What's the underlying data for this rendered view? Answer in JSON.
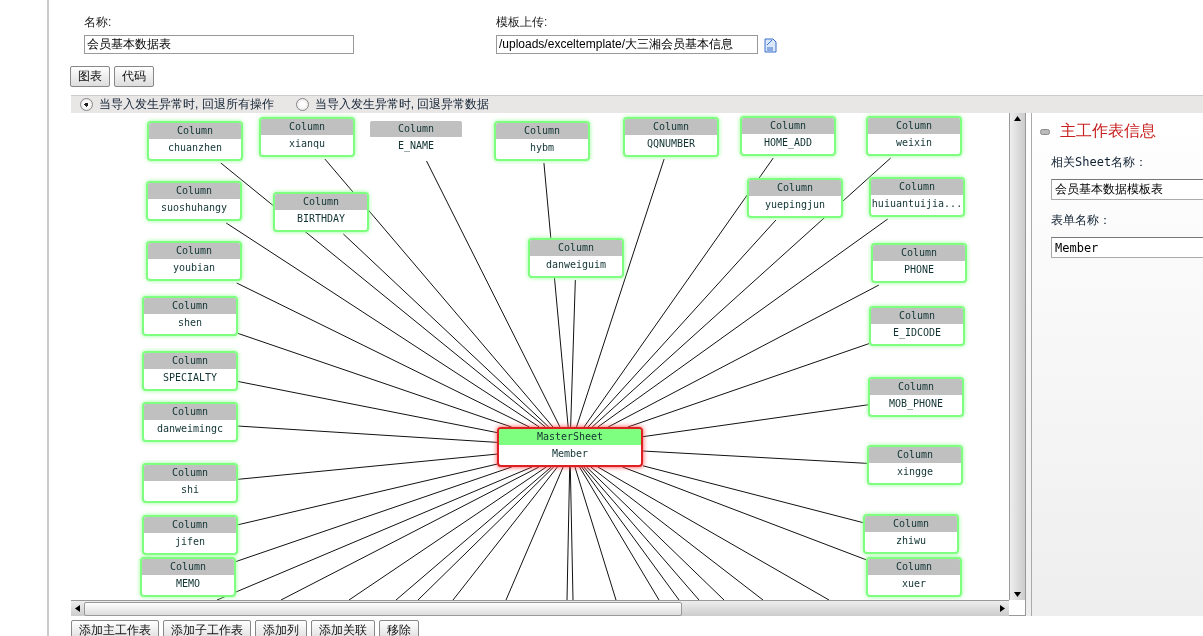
{
  "form": {
    "name_label": "名称:",
    "name_value": "会员基本数据表",
    "upload_label": "模板上传:",
    "upload_value": "/uploads/exceltemplate/大三湘会员基本信息"
  },
  "view_buttons": [
    {
      "label": "图表"
    },
    {
      "label": "代码"
    }
  ],
  "rollback_options": [
    {
      "label": "当导入发生异常时, 回退所有操作",
      "selected": true
    },
    {
      "label": "当导入发生异常时, 回退异常数据",
      "selected": false
    }
  ],
  "diagram": {
    "master": {
      "header": "MasterSheet",
      "name": "Member"
    },
    "columns": [
      {
        "kind": "node",
        "header": "Column",
        "name": "chuanzhen"
      },
      {
        "kind": "node",
        "header": "Column",
        "name": "xianqu"
      },
      {
        "kind": "plain",
        "header": "Column",
        "name": "E_NAME"
      },
      {
        "kind": "node",
        "header": "Column",
        "name": "hybm"
      },
      {
        "kind": "node",
        "header": "Column",
        "name": "QQNUMBER"
      },
      {
        "kind": "node",
        "header": "Column",
        "name": "HOME_ADD"
      },
      {
        "kind": "node",
        "header": "Column",
        "name": "weixin"
      },
      {
        "kind": "node",
        "header": "Column",
        "name": "suoshuhangy"
      },
      {
        "kind": "node",
        "header": "Column",
        "name": "BIRTHDAY"
      },
      {
        "kind": "node",
        "header": "Column",
        "name": "yuepingjun"
      },
      {
        "kind": "node",
        "header": "Column",
        "name": "huiuantuijia..."
      },
      {
        "kind": "node",
        "header": "Column",
        "name": "youbian"
      },
      {
        "kind": "node",
        "header": "Column",
        "name": "danweiguim"
      },
      {
        "kind": "node",
        "header": "Column",
        "name": "PHONE"
      },
      {
        "kind": "node",
        "header": "Column",
        "name": "shen"
      },
      {
        "kind": "node",
        "header": "Column",
        "name": "E_IDCODE"
      },
      {
        "kind": "node",
        "header": "Column",
        "name": "SPECIALTY"
      },
      {
        "kind": "node",
        "header": "Column",
        "name": "MOB_PHONE"
      },
      {
        "kind": "node",
        "header": "Column",
        "name": "danweimingc"
      },
      {
        "kind": "node",
        "header": "Column",
        "name": "xingge"
      },
      {
        "kind": "node",
        "header": "Column",
        "name": "shi"
      },
      {
        "kind": "node",
        "header": "Column",
        "name": "jifen"
      },
      {
        "kind": "node",
        "header": "Column",
        "name": "zhiwu"
      },
      {
        "kind": "node",
        "header": "Column",
        "name": "MEMO"
      },
      {
        "kind": "node",
        "header": "Column",
        "name": "xuer"
      }
    ]
  },
  "side_panel": {
    "title": "主工作表信息",
    "fields": [
      {
        "label": "相关Sheet名称：",
        "value": "会员基本数据模板表"
      },
      {
        "label": "表单名称：",
        "value": "Member"
      }
    ]
  },
  "actions": [
    {
      "label": "添加主工作表"
    },
    {
      "label": "添加子工作表"
    },
    {
      "label": "添加列"
    },
    {
      "label": "添加关联"
    },
    {
      "label": "移除"
    }
  ]
}
